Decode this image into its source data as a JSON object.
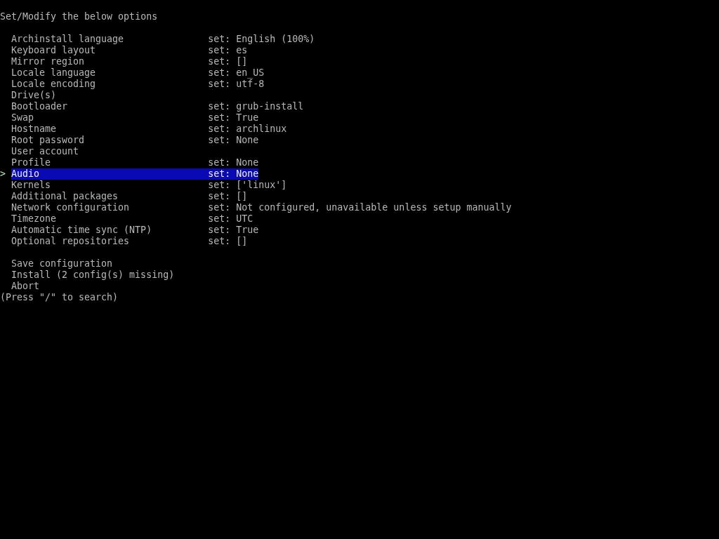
{
  "title": "Set/Modify the below options",
  "cursor": ">",
  "options": [
    {
      "label": "Archinstall language",
      "value": "set: English (100%)",
      "selected": false
    },
    {
      "label": "Keyboard layout",
      "value": "set: es",
      "selected": false
    },
    {
      "label": "Mirror region",
      "value": "set: []",
      "selected": false
    },
    {
      "label": "Locale language",
      "value": "set: en_US",
      "selected": false
    },
    {
      "label": "Locale encoding",
      "value": "set: utf-8",
      "selected": false
    },
    {
      "label": "Drive(s)",
      "selected": false
    },
    {
      "label": "Bootloader",
      "value": "set: grub-install",
      "selected": false
    },
    {
      "label": "Swap",
      "value": "set: True",
      "selected": false
    },
    {
      "label": "Hostname",
      "value": "set: archlinux",
      "selected": false
    },
    {
      "label": "Root password",
      "value": "set: None",
      "selected": false
    },
    {
      "label": "User account",
      "selected": false
    },
    {
      "label": "Profile",
      "value": "set: None",
      "selected": false
    },
    {
      "label": "Audio",
      "value": "set: None",
      "selected": true
    },
    {
      "label": "Kernels",
      "value": "set: ['linux']",
      "selected": false
    },
    {
      "label": "Additional packages",
      "value": "set: []",
      "selected": false
    },
    {
      "label": "Network configuration",
      "value": "set: Not configured, unavailable unless setup manually",
      "selected": false
    },
    {
      "label": "Timezone",
      "value": "set: UTC",
      "selected": false
    },
    {
      "label": "Automatic time sync (NTP)",
      "value": "set: True",
      "selected": false
    },
    {
      "label": "Optional repositories",
      "value": "set: []",
      "selected": false
    }
  ],
  "actions": [
    {
      "label": "Save configuration",
      "selected": false
    },
    {
      "label": "Install (2 config(s) missing)",
      "selected": false
    },
    {
      "label": "Abort",
      "selected": false
    }
  ],
  "hint": "(Press \"/\" to search)"
}
